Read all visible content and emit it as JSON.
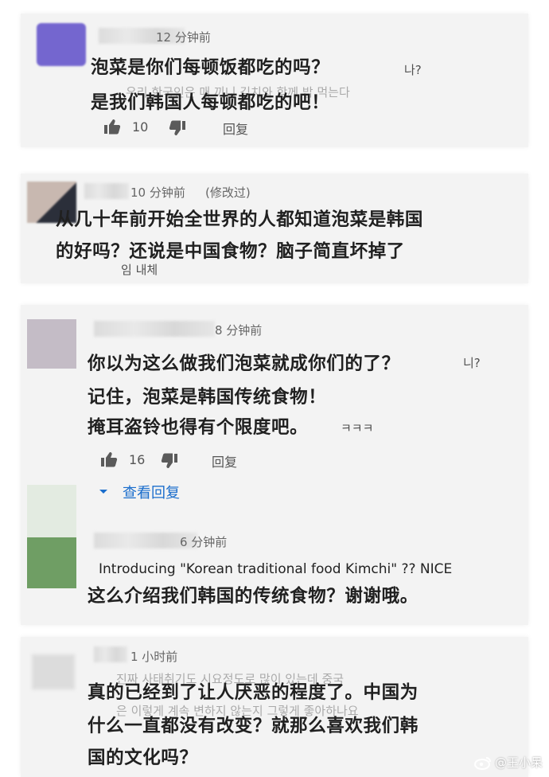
{
  "comments": [
    {
      "time": "12 分钟前",
      "lines": [
        "泡菜是你们每顿饭都吃的吗？",
        "是我们韩国人每顿都吃的吧！"
      ],
      "ghost_inline": "나?",
      "ghost_bg": "우리 한국인은 매 끼니 김치와 함께 밥 먹는다",
      "likes": "10",
      "reply_label": "回复"
    },
    {
      "time": "10 分钟前",
      "edited": "(修改过)",
      "lines": [
        "从几十年前开始全世界的人都知道泡菜是韩国",
        "的好吗？还说是中国食物？脑子简直坏掉了"
      ],
      "ghost_after": "임 내체"
    },
    {
      "time": "8 分钟前",
      "lines": [
        "你以为这么做我们泡菜就成你们的了？",
        "记住，泡菜是韩国传统食物！",
        "掩耳盗铃也得有个限度吧。"
      ],
      "ghost_inline_1": "니?",
      "ghost_inline_3": "ㅋㅋㅋ",
      "likes": "16",
      "reply_label": "回复",
      "view_replies": "查看回复"
    },
    {
      "time": "6 分钟前",
      "english": "Introducing \"Korean traditional food Kimchi\" ?? NICE",
      "lines": [
        "这么介绍我们韩国的传统食物？谢谢哦。"
      ]
    },
    {
      "time": "1 小时前",
      "lines": [
        "真的已经到了让人厌恶的程度了。中国为",
        "什么一直都没有改变？就那么喜欢我们韩",
        "国的文化吗？"
      ],
      "ghost_bg_1": "진짜 사태취기도 시요정도로 많이 있는데 중국",
      "ghost_bg_2": "은 이렇게 계속 변하지 않는지 그렇게 좋아하나요"
    }
  ],
  "watermark": "@王小呆",
  "colors": {
    "link": "#1a6dcc",
    "card_bg": "#f3f3f3",
    "avatar_purple": "#6a5cc8",
    "avatar_green": "#6f9e64"
  }
}
